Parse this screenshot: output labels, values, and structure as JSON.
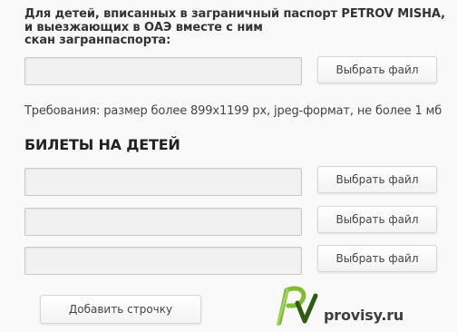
{
  "passport_label": {
    "line1": "Для детей, вписанных в заграничный паспорт PETROV MISHA,",
    "line2": "и выезжающих в ОАЭ вместе с ним",
    "line3": "скан загранпаспорта:"
  },
  "passport_field": {
    "value": "",
    "button_label": "Выбрать файл"
  },
  "requirements_text": "Требования: размер более 899x1199 px, jpeg-формат, не более 1 мб",
  "tickets_section": {
    "title": "БИЛЕТЫ НА ДЕТЕЙ",
    "rows": [
      {
        "value": "",
        "button_label": "Выбрать файл"
      },
      {
        "value": "",
        "button_label": "Выбрать файл"
      },
      {
        "value": "",
        "button_label": "Выбрать файл"
      }
    ],
    "add_row_label": "Добавить строчку"
  },
  "watermark": {
    "logo_letters": "Pv",
    "site": "provisy.ru",
    "colors": {
      "green": "#8cc63f",
      "dark": "#2f4f1f"
    }
  }
}
